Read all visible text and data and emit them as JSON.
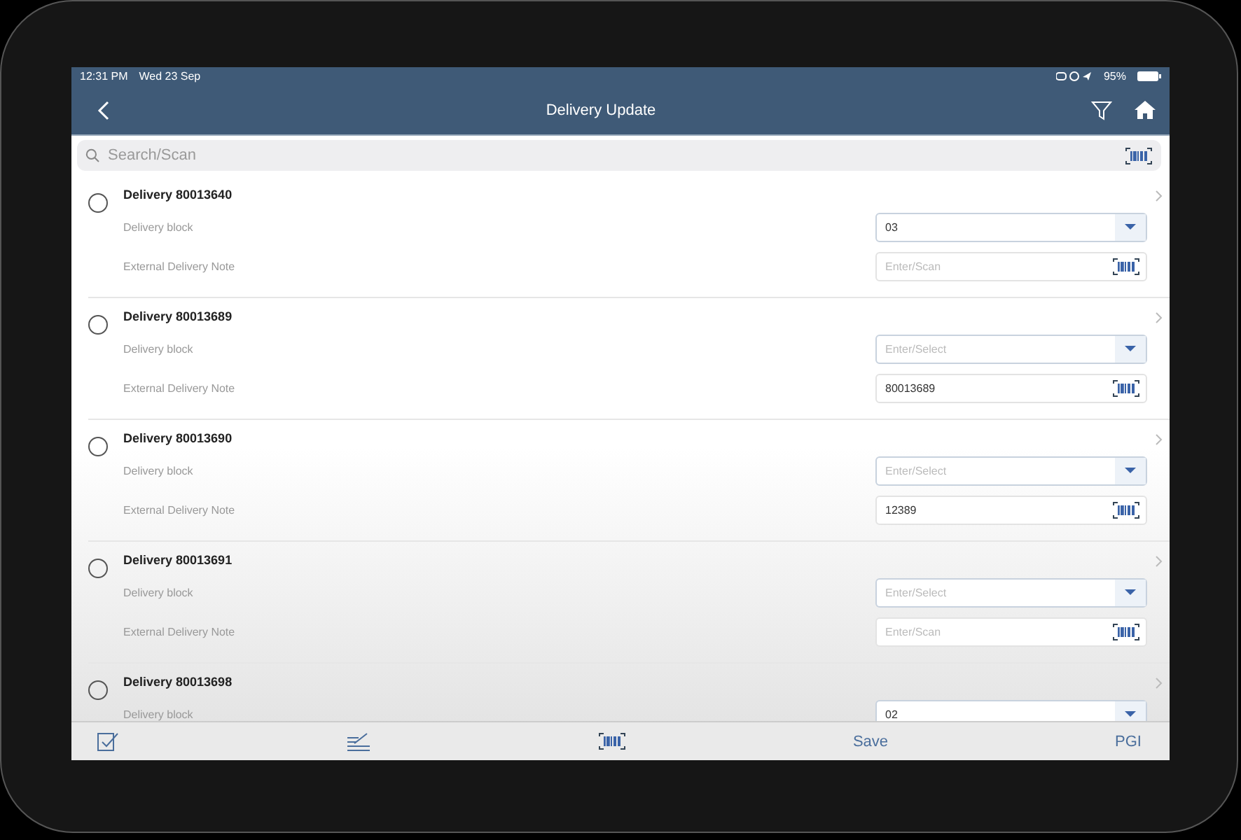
{
  "status_bar": {
    "time": "12:31 PM",
    "date": "Wed 23 Sep",
    "battery": "95%"
  },
  "nav_bar": {
    "title": "Delivery Update"
  },
  "search": {
    "placeholder": "Search/Scan"
  },
  "deliveries": [
    {
      "title": "Delivery 80013640",
      "selected": false,
      "block": {
        "label": "Delivery block",
        "value": "03"
      },
      "note": {
        "label": "External Delivery Note",
        "placeholder": "Enter/Scan"
      }
    },
    {
      "title": "Delivery 80013689",
      "selected": false,
      "block": {
        "label": "Delivery block",
        "placeholder": "Enter/Select"
      },
      "note": {
        "label": "External Delivery Note",
        "value": "80013689"
      }
    },
    {
      "title": "Delivery 80013690",
      "selected": false,
      "block": {
        "label": "Delivery block",
        "placeholder": "Enter/Select"
      },
      "note": {
        "label": "External Delivery Note",
        "value": "12389"
      }
    },
    {
      "title": "Delivery 80013691",
      "selected": false,
      "block": {
        "label": "Delivery block",
        "placeholder": "Enter/Select"
      },
      "note": {
        "label": "External Delivery Note",
        "placeholder": "Enter/Scan"
      }
    },
    {
      "title": "Delivery 80013698",
      "selected": false,
      "block": {
        "label": "Delivery block",
        "value": "02"
      }
    }
  ],
  "toolbar": {
    "save": "Save",
    "pgi": "PGI"
  }
}
